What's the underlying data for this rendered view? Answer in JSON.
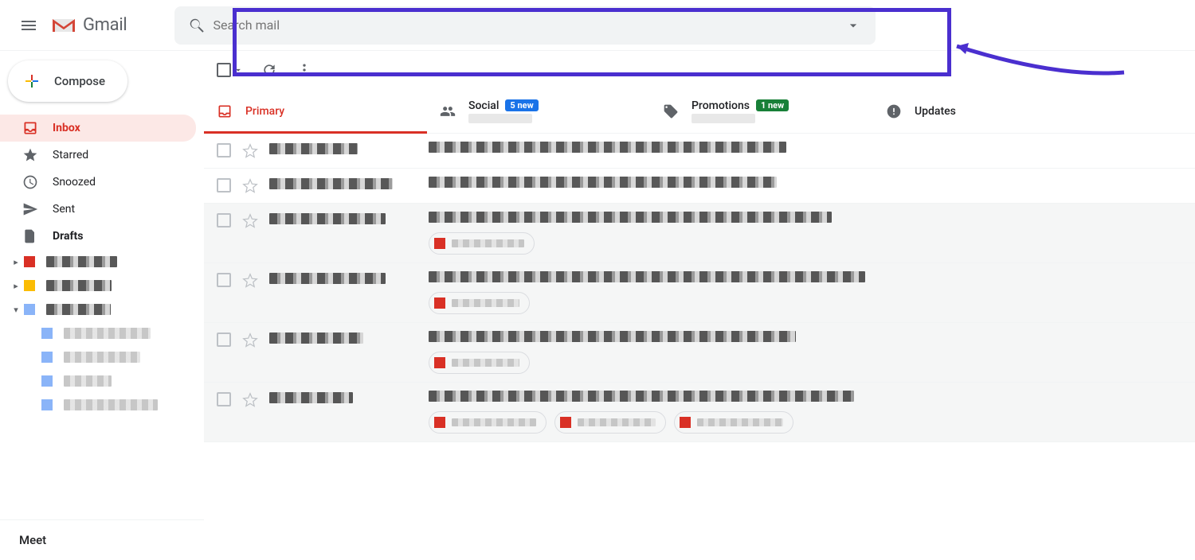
{
  "app": {
    "name": "Gmail"
  },
  "header": {
    "search_placeholder": "Search mail"
  },
  "compose": {
    "label": "Compose"
  },
  "sidebar": {
    "items": [
      {
        "id": "inbox",
        "label": "Inbox",
        "icon": "inbox",
        "active": true,
        "bold": true
      },
      {
        "id": "starred",
        "label": "Starred",
        "icon": "star",
        "active": false,
        "bold": false
      },
      {
        "id": "snoozed",
        "label": "Snoozed",
        "icon": "clock",
        "active": false,
        "bold": false
      },
      {
        "id": "sent",
        "label": "Sent",
        "icon": "send",
        "active": false,
        "bold": false
      },
      {
        "id": "drafts",
        "label": "Drafts",
        "icon": "file",
        "active": false,
        "bold": true
      }
    ],
    "labels": [
      {
        "color": "#d93025",
        "expanded": false,
        "sub": []
      },
      {
        "color": "#fbbc04",
        "expanded": false,
        "sub": []
      },
      {
        "color": "#8ab4f8",
        "expanded": true,
        "sub": [
          {
            "color": "#8ab4f8"
          },
          {
            "color": "#8ab4f8"
          },
          {
            "color": "#8ab4f8"
          },
          {
            "color": "#8ab4f8"
          }
        ]
      }
    ],
    "meet_label": "Meet"
  },
  "tabs": [
    {
      "id": "primary",
      "label": "Primary",
      "active": true,
      "badge": null
    },
    {
      "id": "social",
      "label": "Social",
      "active": false,
      "badge": {
        "text": "5 new",
        "style": "blue"
      }
    },
    {
      "id": "promotions",
      "label": "Promotions",
      "active": false,
      "badge": {
        "text": "1 new",
        "style": "green"
      }
    },
    {
      "id": "updates",
      "label": "Updates",
      "active": false,
      "badge": null
    }
  ],
  "messages": [
    {
      "unread": true,
      "attachments": 0
    },
    {
      "unread": true,
      "attachments": 0
    },
    {
      "unread": false,
      "attachments": 1
    },
    {
      "unread": false,
      "attachments": 1
    },
    {
      "unread": false,
      "attachments": 1
    },
    {
      "unread": false,
      "attachments": 3
    }
  ],
  "annotation": {
    "highlight_target": "search-box",
    "color": "#4a2fcf"
  }
}
